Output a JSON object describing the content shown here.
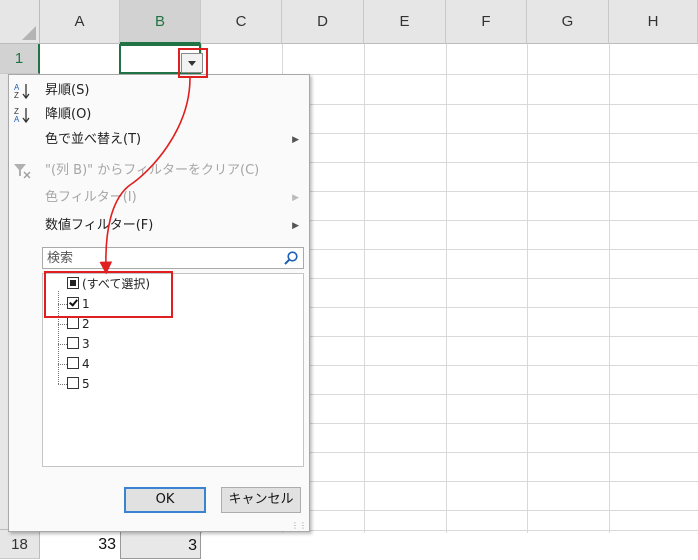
{
  "grid": {
    "columns": [
      "A",
      "B",
      "C",
      "D",
      "E",
      "F",
      "G",
      "H"
    ],
    "selected_column": "B",
    "rows": [
      "1",
      "18"
    ],
    "cells": {
      "A18": "33",
      "B18": "3"
    }
  },
  "filter_menu": {
    "sort_asc": {
      "label": "昇順(S)",
      "icon": "sort-ascending-icon"
    },
    "sort_desc": {
      "label": "降順(O)",
      "icon": "sort-descending-icon"
    },
    "sort_by_color": "色で並べ替え(T)",
    "clear_filter": {
      "label": "\"(列 B)\" からフィルターをクリア(C)",
      "icon": "clear-filter-icon"
    },
    "color_filter": "色フィルター(I)",
    "number_filter": "数値フィルター(F)",
    "search": {
      "placeholder": "検索"
    },
    "list": [
      {
        "label": "(すべて選択)",
        "state": "partial"
      },
      {
        "label": "1",
        "state": "checked"
      },
      {
        "label": "2",
        "state": "unchecked"
      },
      {
        "label": "3",
        "state": "unchecked"
      },
      {
        "label": "4",
        "state": "unchecked"
      },
      {
        "label": "5",
        "state": "unchecked"
      }
    ],
    "ok_label": "OK",
    "cancel_label": "キャンセル"
  },
  "colors": {
    "accent": "#217346",
    "annotation": "#e02020",
    "ok_focus": "#3a82d2"
  }
}
